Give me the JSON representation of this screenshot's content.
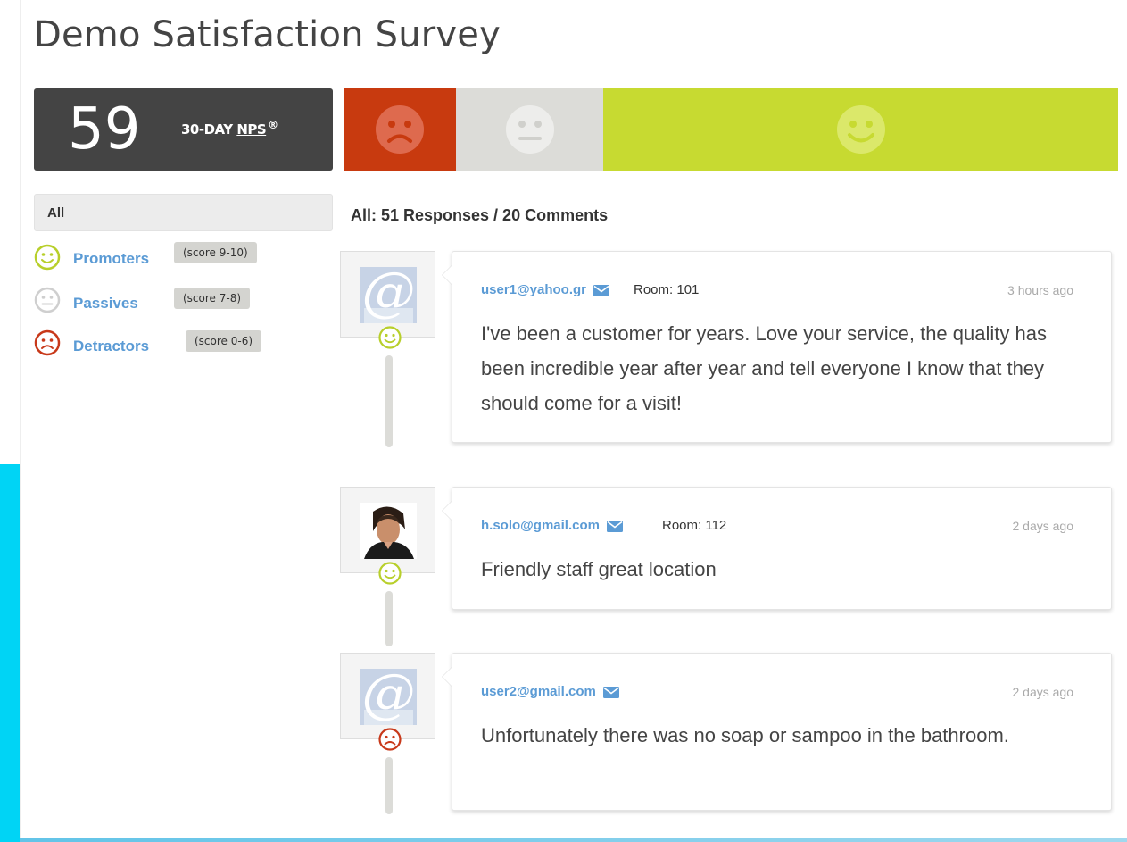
{
  "title": "Demo Satisfaction Survey",
  "nps": {
    "score": "59",
    "label_prefix": "30-DAY ",
    "label_nps": "NPS",
    "registered": "®"
  },
  "distribution": {
    "detractors_color": "#c83a0f",
    "passives_color": "#dcdcd8",
    "promoters_color": "#c7da31",
    "icons": [
      "sad-face-icon",
      "neutral-face-icon",
      "happy-face-icon"
    ]
  },
  "filters": {
    "all_label": "All",
    "items": [
      {
        "label": "Promoters",
        "score": "(score 9-10)",
        "icon": "happy-face-icon",
        "color": "#b8cf2b"
      },
      {
        "label": "Passives",
        "score": "(score 7-8)",
        "icon": "neutral-face-icon",
        "color": "#cfcfcf"
      },
      {
        "label": "Detractors",
        "score": "(score 0-6)",
        "icon": "sad-face-icon",
        "color": "#c8391a"
      }
    ]
  },
  "summary": "All: 51 Responses / 20 Comments",
  "responses": [
    {
      "email": "user1@yahoo.gr",
      "room": "Room: 101",
      "time": "3 hours ago",
      "text": "I've been a customer for years. Love your service, the quality has been incredible year after year and tell everyone I know that they should come for a visit!",
      "sentiment": "promoter",
      "avatar": "at-sign-avatar"
    },
    {
      "email": "h.solo@gmail.com",
      "room": "Room: 112",
      "time": "2 days ago",
      "text": "Friendly staff great location",
      "sentiment": "promoter",
      "avatar": "photo-avatar"
    },
    {
      "email": "user2@gmail.com",
      "room": "",
      "time": "2 days ago",
      "text": "Unfortunately there was no soap or sampoo in the bathroom.",
      "sentiment": "detractor",
      "avatar": "at-sign-avatar"
    }
  ],
  "colors": {
    "link": "#5b9bd5",
    "nps_bg": "#444444",
    "accent": "#00d4f5"
  }
}
